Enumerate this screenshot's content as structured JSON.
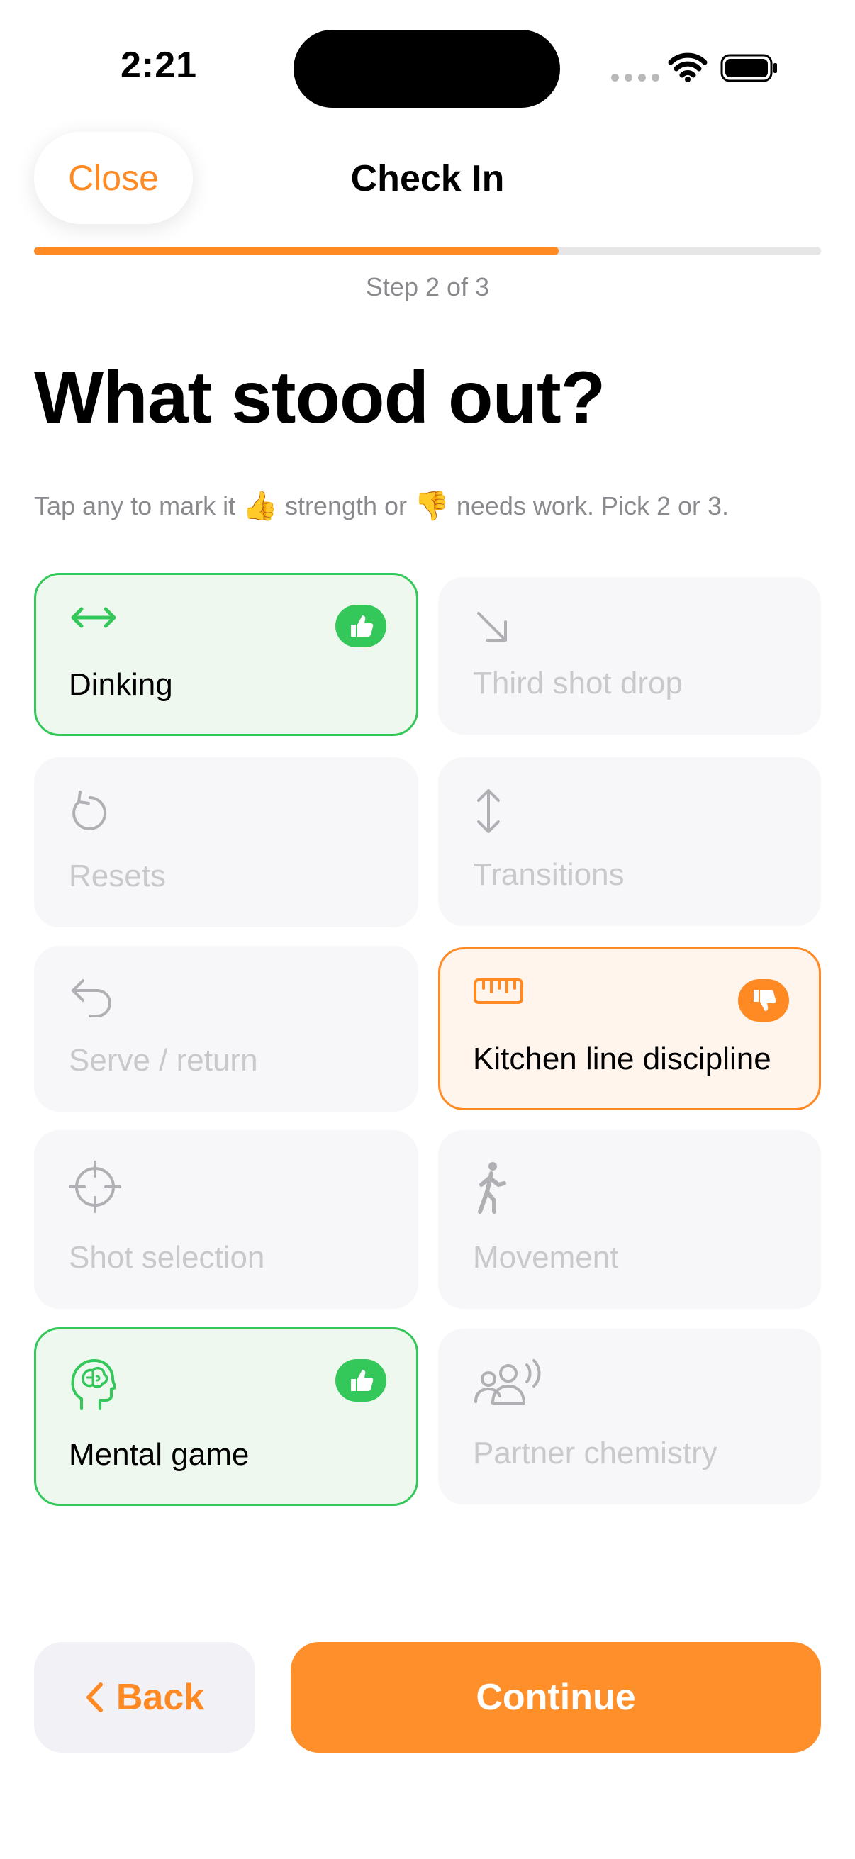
{
  "status_bar": {
    "time": "2:21"
  },
  "header": {
    "close_label": "Close",
    "title": "Check In"
  },
  "progress": {
    "fraction": 0.667,
    "step_label": "Step 2 of 3"
  },
  "page": {
    "title": "What stood out?",
    "subtitle_part1": "Tap any to mark it",
    "subtitle_emoji1": "👍",
    "subtitle_part2": "strength or",
    "subtitle_emoji2": "👎",
    "subtitle_part3": "needs work. Pick 2 or 3."
  },
  "items": [
    {
      "label": "Dinking",
      "icon": "left-right-arrow-icon",
      "state": "strength"
    },
    {
      "label": "Third shot drop",
      "icon": "arrow-down-right-icon",
      "state": "none"
    },
    {
      "label": "Resets",
      "icon": "counterclockwise-arrow-icon",
      "state": "none"
    },
    {
      "label": "Transitions",
      "icon": "up-down-arrow-icon",
      "state": "none"
    },
    {
      "label": "Serve / return",
      "icon": "return-arrow-icon",
      "state": "none"
    },
    {
      "label": "Kitchen line discipline",
      "icon": "ruler-icon",
      "state": "needs-work"
    },
    {
      "label": "Shot selection",
      "icon": "crosshair-icon",
      "state": "none"
    },
    {
      "label": "Movement",
      "icon": "walking-figure-icon",
      "state": "none"
    },
    {
      "label": "Mental game",
      "icon": "head-brain-icon",
      "state": "strength"
    },
    {
      "label": "Partner chemistry",
      "icon": "people-talking-icon",
      "state": "none"
    }
  ],
  "footer": {
    "back_label": "Back",
    "continue_label": "Continue"
  },
  "colors": {
    "accent": "#ff8a24",
    "strength": "#34c759",
    "inactive": "#c9c9cc"
  }
}
